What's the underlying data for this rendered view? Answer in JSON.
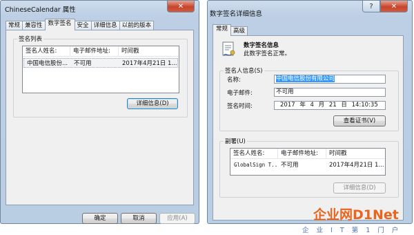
{
  "left_window": {
    "title": "ChineseCalendar 属性",
    "tabs": [
      "常规",
      "兼容性",
      "数字签名",
      "安全",
      "详细信息",
      "以前的版本"
    ],
    "active_tab": "数字签名",
    "signature_list": {
      "label": "签名列表",
      "columns": [
        "签名人姓名:",
        "电子邮件地址:",
        "时间戳"
      ],
      "rows": [
        {
          "name": "中国电信股份...",
          "email": "不可用",
          "timestamp": "2017年4月21日 1..."
        }
      ]
    },
    "details_button": "详细信息(D)",
    "ok_button": "确定",
    "cancel_button": "取消",
    "apply_button": "应用(A)"
  },
  "right_window": {
    "title": "数字签名详细信息",
    "tabs": [
      "常规",
      "高级"
    ],
    "active_tab": "常规",
    "info_title": "数字签名信息",
    "info_status": "此数字签名正常。",
    "signer_group_label": "签名人信息(S)",
    "name_label": "名称:",
    "name_value": "中国电信股份有限公司",
    "email_label": "电子邮件:",
    "email_value": "不可用",
    "time_label": "签名时间:",
    "time_value": "2017 年 4 月 21 日 14:10:35",
    "view_cert_button": "查看证书(V)",
    "countersign_group_label": "副署(U)",
    "countersign_list": {
      "columns": [
        "签名人姓名:",
        "电子邮件地址:",
        "时间戳"
      ],
      "rows": [
        {
          "name": "GlobalSign T...",
          "email": "不可用",
          "timestamp": "2017年4月21日 1..."
        }
      ]
    },
    "details_button": "详细信息(D)"
  },
  "watermark": {
    "main": "企业网D1Net",
    "sub": "企 业 I T 第 1 门 户"
  }
}
